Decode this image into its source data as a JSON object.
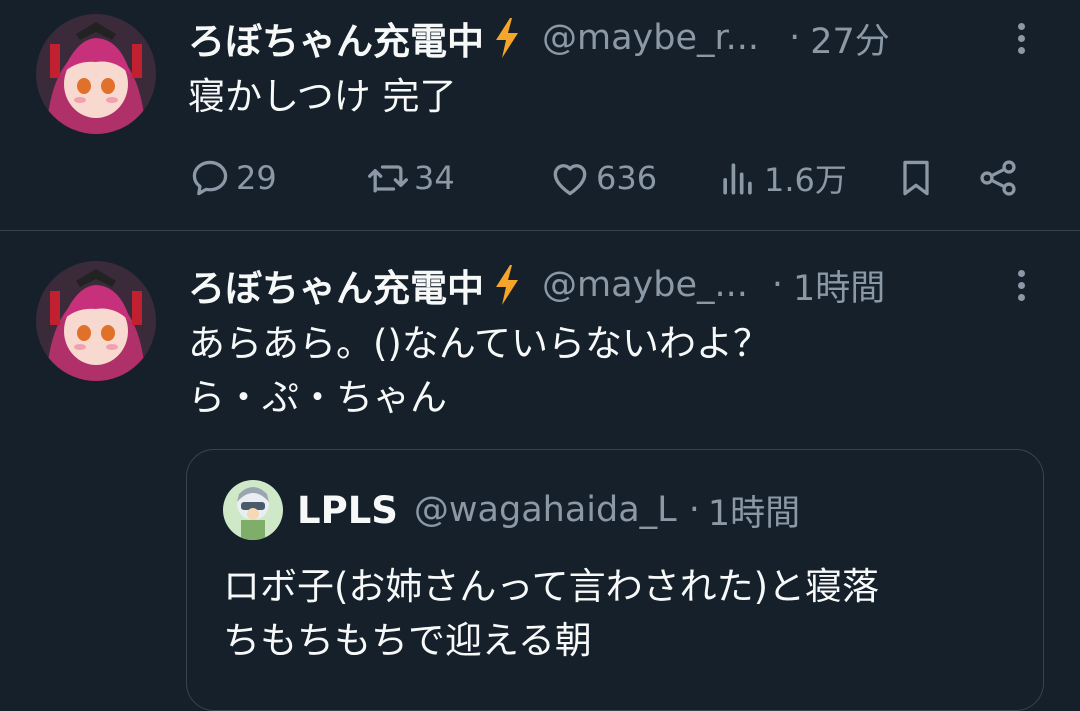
{
  "tweets": [
    {
      "display_name": "ろぼちゃん充電中",
      "badge_icon": "lightning-bolt-icon",
      "handle": "@maybe_r...",
      "separator": "·",
      "time": "27分",
      "text": "寝かしつけ 完了",
      "actions": {
        "replies": "29",
        "retweets": "34",
        "likes": "636",
        "views": "1.6万"
      }
    },
    {
      "display_name": "ろぼちゃん充電中",
      "badge_icon": "lightning-bolt-icon",
      "handle": "@maybe_...",
      "separator": "·",
      "time": "1時間",
      "text": "あらあら。()なんていらないわよ？\nら・ぷ・ちゃん",
      "quote": {
        "display_name": "LPLS",
        "handle": "@wagahaida_L",
        "separator": "·",
        "time": "1時間",
        "text": "ロボ子(お姉さんって言わされた)と寝落\nちもちもちで迎える朝"
      }
    }
  ],
  "colors": {
    "background": "#15202b",
    "divider": "#38444d",
    "primary_text": "#f7f9f9",
    "secondary_text": "#8b98a5",
    "bolt": "#f4a52a"
  }
}
